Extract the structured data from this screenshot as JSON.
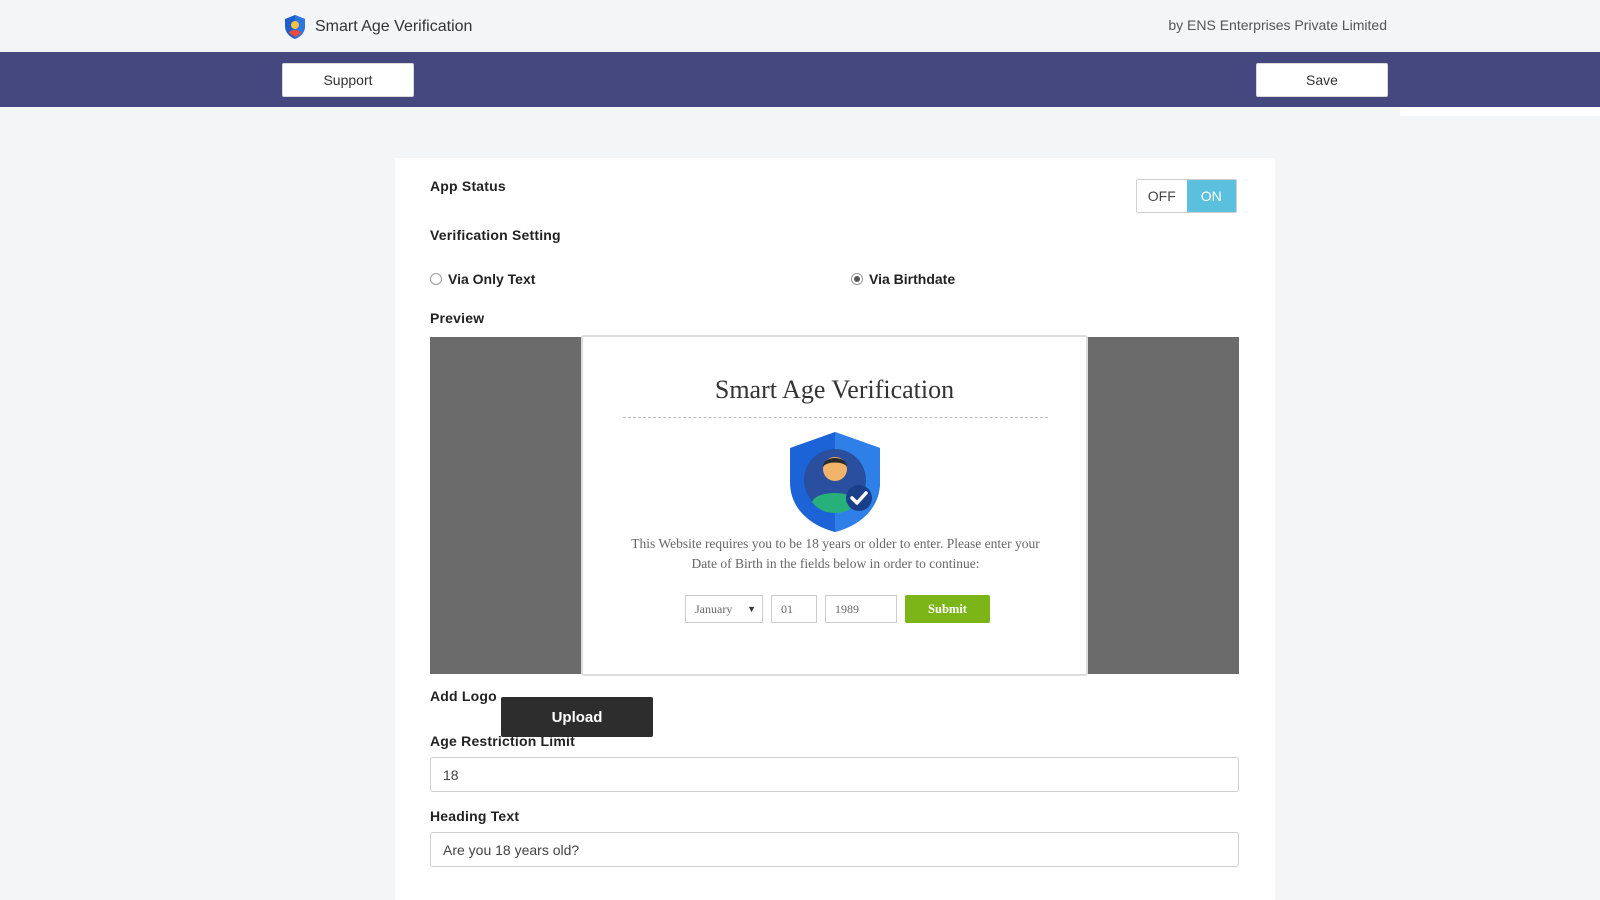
{
  "header": {
    "title": "Smart Age Verification",
    "vendor": "by ENS Enterprises Private Limited"
  },
  "toolbar": {
    "support_label": "Support",
    "save_label": "Save"
  },
  "settings": {
    "app_status_label": "App Status",
    "toggle_off": "OFF",
    "toggle_on": "ON",
    "verification_label": "Verification Setting",
    "radio_text": "Via Only Text",
    "radio_birthdate": "Via Birthdate",
    "preview_label": "Preview",
    "add_logo_label": "Add Logo",
    "upload_label": "Upload",
    "age_limit_label": "Age Restriction Limit",
    "age_limit_value": "18",
    "heading_text_label": "Heading Text",
    "heading_text_value": "Are you 18 years old?"
  },
  "preview": {
    "title": "Smart Age Verification",
    "message": "This Website requires you to be 18 years or older to enter. Please enter your Date of Birth in the fields below in order to continue:",
    "month": "January",
    "day": "01",
    "year": "1989",
    "submit": "Submit"
  },
  "colors": {
    "navbar": "#45487e",
    "toggle_on": "#5bc0de",
    "submit": "#7cb518"
  }
}
